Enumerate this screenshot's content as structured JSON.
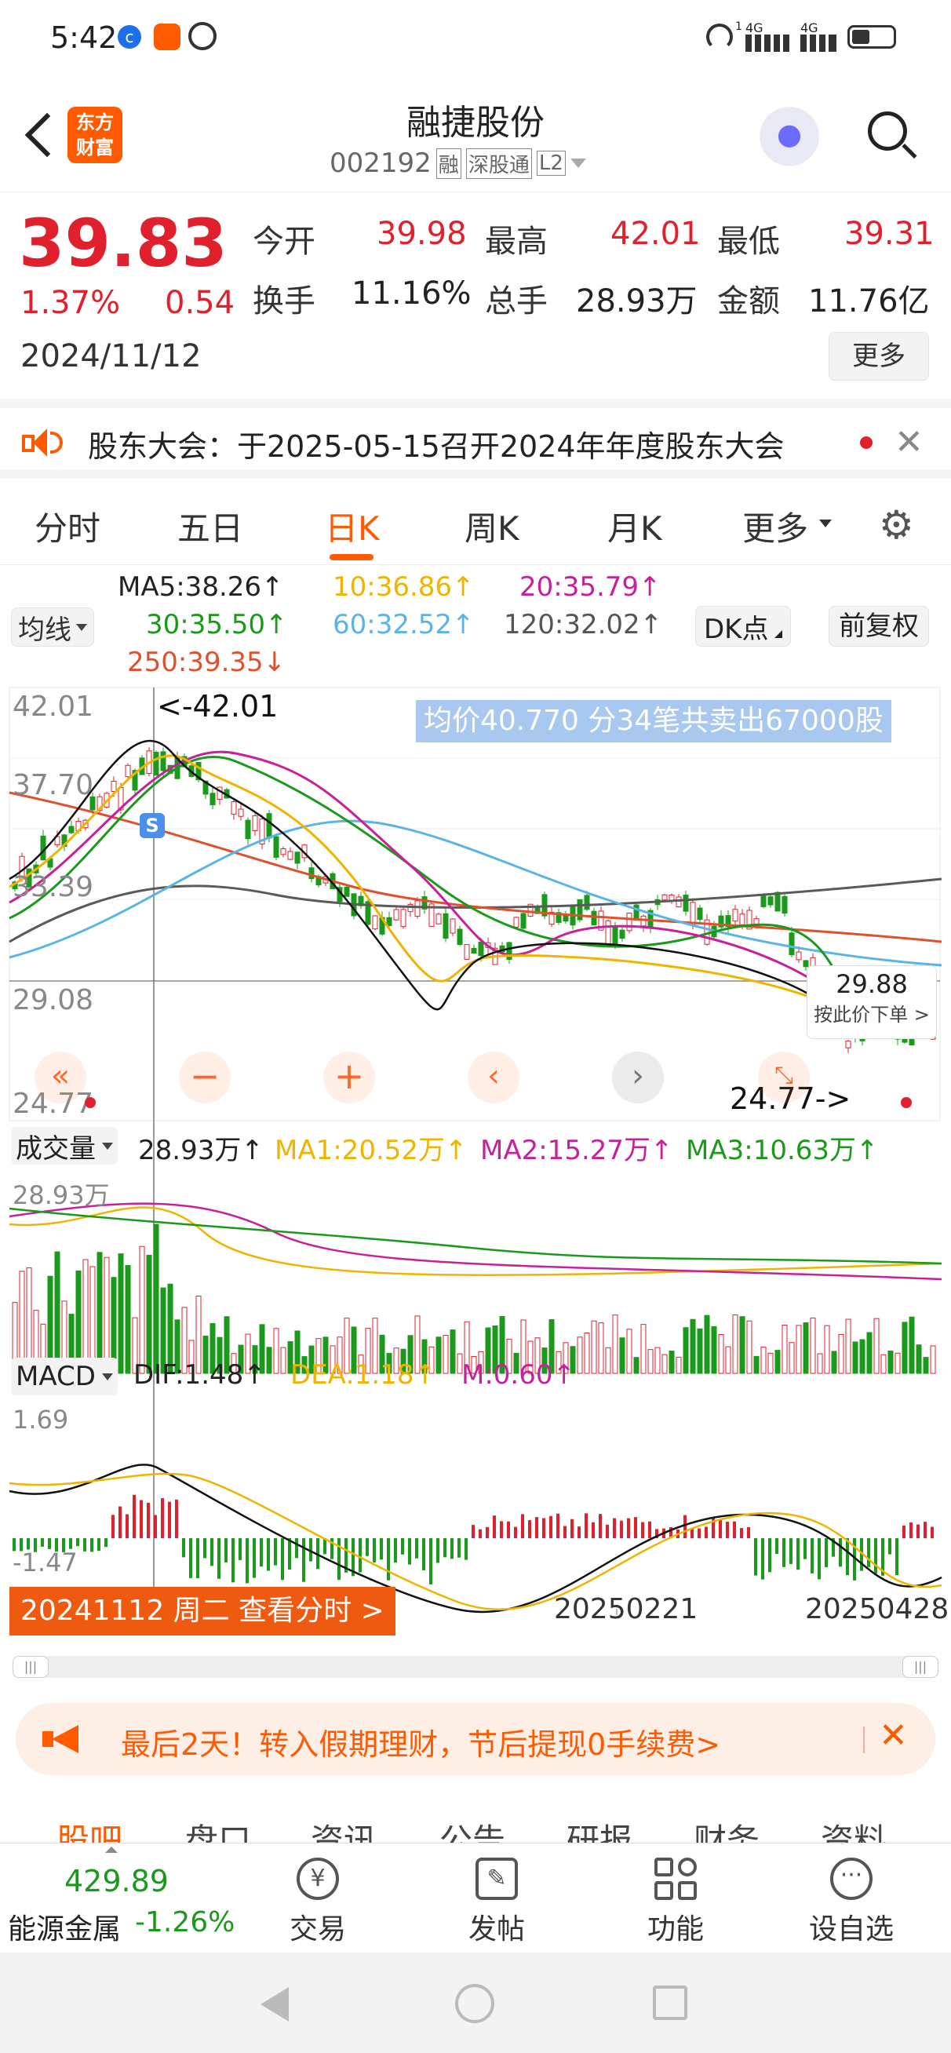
{
  "status": {
    "time": "5:42",
    "net_4g_1": "4G",
    "net_4g_2": "4G",
    "sim1": "1"
  },
  "header": {
    "logo_line1": "东方",
    "logo_line2": "财富",
    "title": "融捷股份",
    "code": "002192",
    "tag_rong": "融",
    "tag_sgt": "深股通",
    "tag_l2": "L2"
  },
  "quote": {
    "price": "39.83",
    "change_pct": "1.37%",
    "change": "0.54",
    "date": "2024/11/12",
    "open_label": "今开",
    "open": "39.98",
    "high_label": "最高",
    "high": "42.01",
    "low_label": "最低",
    "low": "39.31",
    "turnover_label": "换手",
    "turnover": "11.16%",
    "volume_label": "总手",
    "volume": "28.93万",
    "amount_label": "金额",
    "amount": "11.76亿",
    "more_label": "更多"
  },
  "notice": {
    "text": "股东大会：于2025-05-15召开2024年年度股东大会"
  },
  "tabs": [
    "分时",
    "五日",
    "日K",
    "周K",
    "月K",
    "更多"
  ],
  "active_tab": "日K",
  "ma": {
    "selector": "均线",
    "ma5": "MA5:38.26↑",
    "ma10": "10:36.86↑",
    "ma20": "20:35.79↑",
    "ma30": "30:35.50↑",
    "ma60": "60:32.52↑",
    "ma120": "120:32.02↑",
    "ma250": "250:39.35↓",
    "dk_label": "DK点",
    "fq_label": "前复权"
  },
  "kline": {
    "y_labels": [
      "42.01",
      "37.70",
      "33.39",
      "29.08",
      "24.77"
    ],
    "tooltip": "均价40.770  分34笔共卖出67000股",
    "high_marker": "<-42.01",
    "low_marker": "24.77->",
    "price_tag": "29.88",
    "price_tag_sub": "按此价下单 >",
    "s_badge": "S"
  },
  "volume": {
    "selector": "成交量",
    "value": "28.93万↑",
    "ma1": "MA1:20.52万↑",
    "ma2": "MA2:15.27万↑",
    "ma3": "MA3:10.63万↑",
    "max_label": "28.93万"
  },
  "macd": {
    "selector": "MACD",
    "dif": "DIF:1.48↑",
    "dea": "DEA:1.18↑",
    "m": "M:0.60↑",
    "top": "1.69",
    "bottom": "-1.47"
  },
  "timeline": {
    "selected": "20241112 周二 查看分时 >",
    "d1": "20250221",
    "d2": "20250428"
  },
  "ad": {
    "text": "最后2天！转入假期理财，节后提现0手续费>"
  },
  "bottom_tabs": [
    "股吧",
    "盘口",
    "资讯",
    "公告",
    "研报",
    "财务",
    "资料"
  ],
  "bottom_bar": {
    "index_value": "429.89",
    "index_name": "能源金属",
    "index_change": "-1.26%",
    "trade": "交易",
    "post": "发帖",
    "func": "功能",
    "watch": "设自选"
  },
  "colors": {
    "up": "#e0202c",
    "down": "#1a9a1a",
    "brand": "#ff5a00",
    "tab_active": "#ff5a00"
  }
}
